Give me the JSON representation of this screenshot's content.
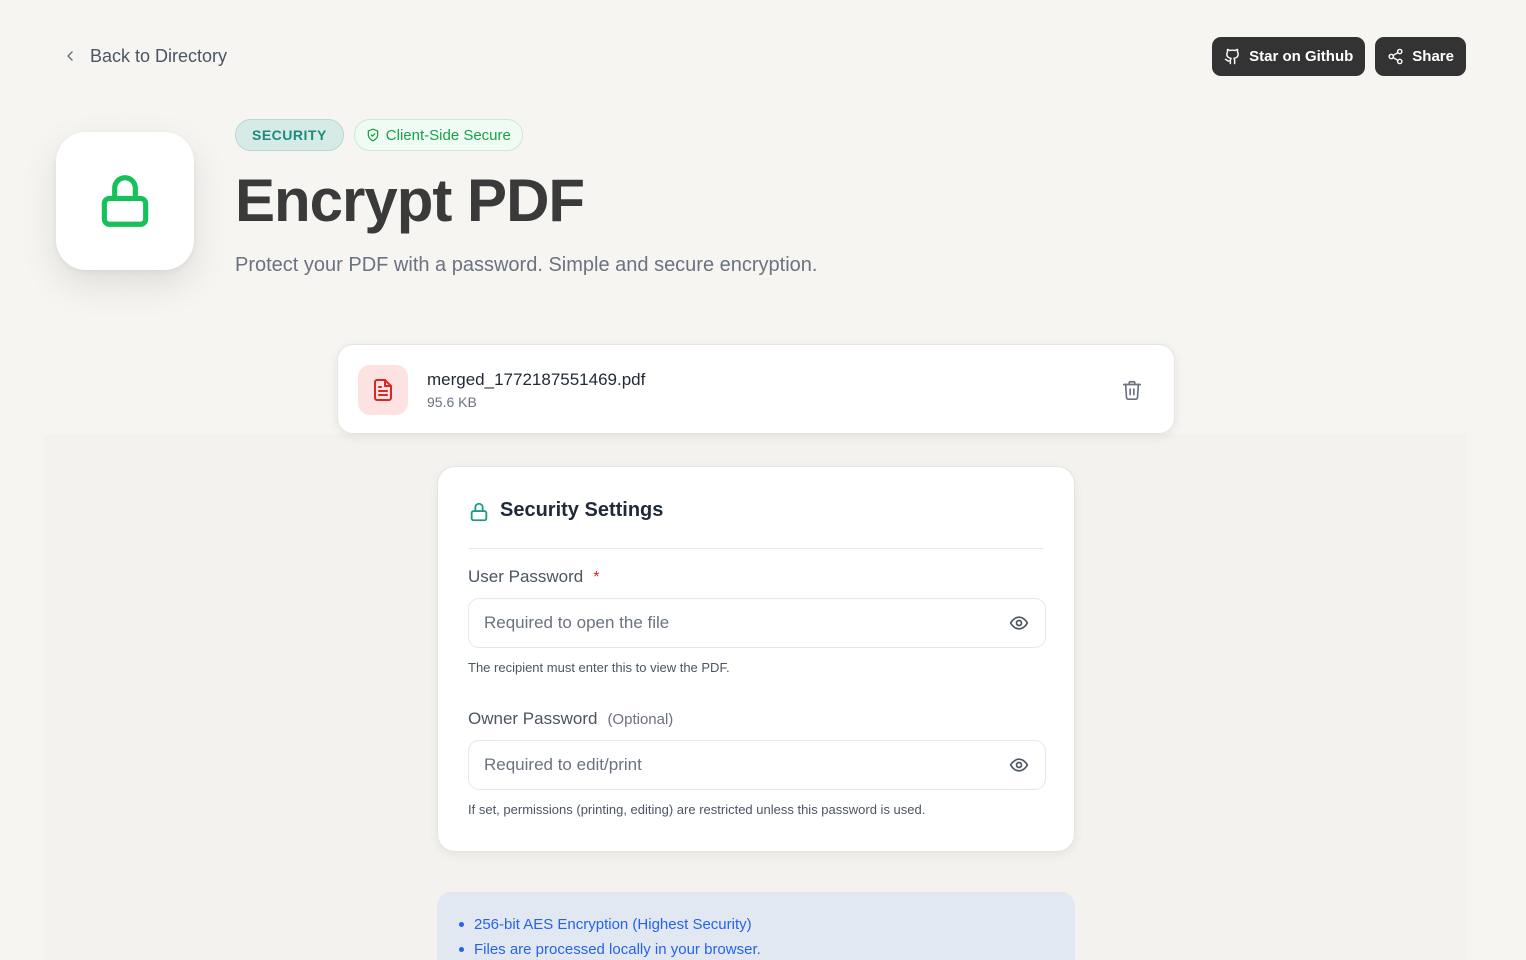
{
  "nav": {
    "back_label": "Back to Directory"
  },
  "actions": {
    "github_label": "Star on Github",
    "share_label": "Share"
  },
  "hero": {
    "category_badge": "SECURITY",
    "secure_badge": "Client-Side Secure",
    "title": "Encrypt PDF",
    "subtitle": "Protect your PDF with a password. Simple and secure encryption.",
    "icon": "lock-icon"
  },
  "file": {
    "name": "merged_1772187551469.pdf",
    "size": "95.6 KB",
    "icon": "file-text-icon"
  },
  "settings": {
    "title": "Security Settings",
    "user_password": {
      "label": "User Password",
      "required_mark": "*",
      "placeholder": "Required to open the file",
      "value": "",
      "hint": "The recipient must enter this to view the PDF."
    },
    "owner_password": {
      "label": "Owner Password",
      "optional_mark": "(Optional)",
      "placeholder": "Required to edit/print",
      "value": "",
      "hint": "If set, permissions (printing, editing) are restricted unless this password is used."
    }
  },
  "info": {
    "items": [
      "256-bit AES Encryption (Highest Security)",
      "Files are processed locally in your browser."
    ]
  },
  "colors": {
    "accent_green": "#16a34a",
    "accent_teal": "#1f8a7a",
    "danger": "#dc2626",
    "info_blue": "#2563eb",
    "dark_button": "#333333"
  }
}
